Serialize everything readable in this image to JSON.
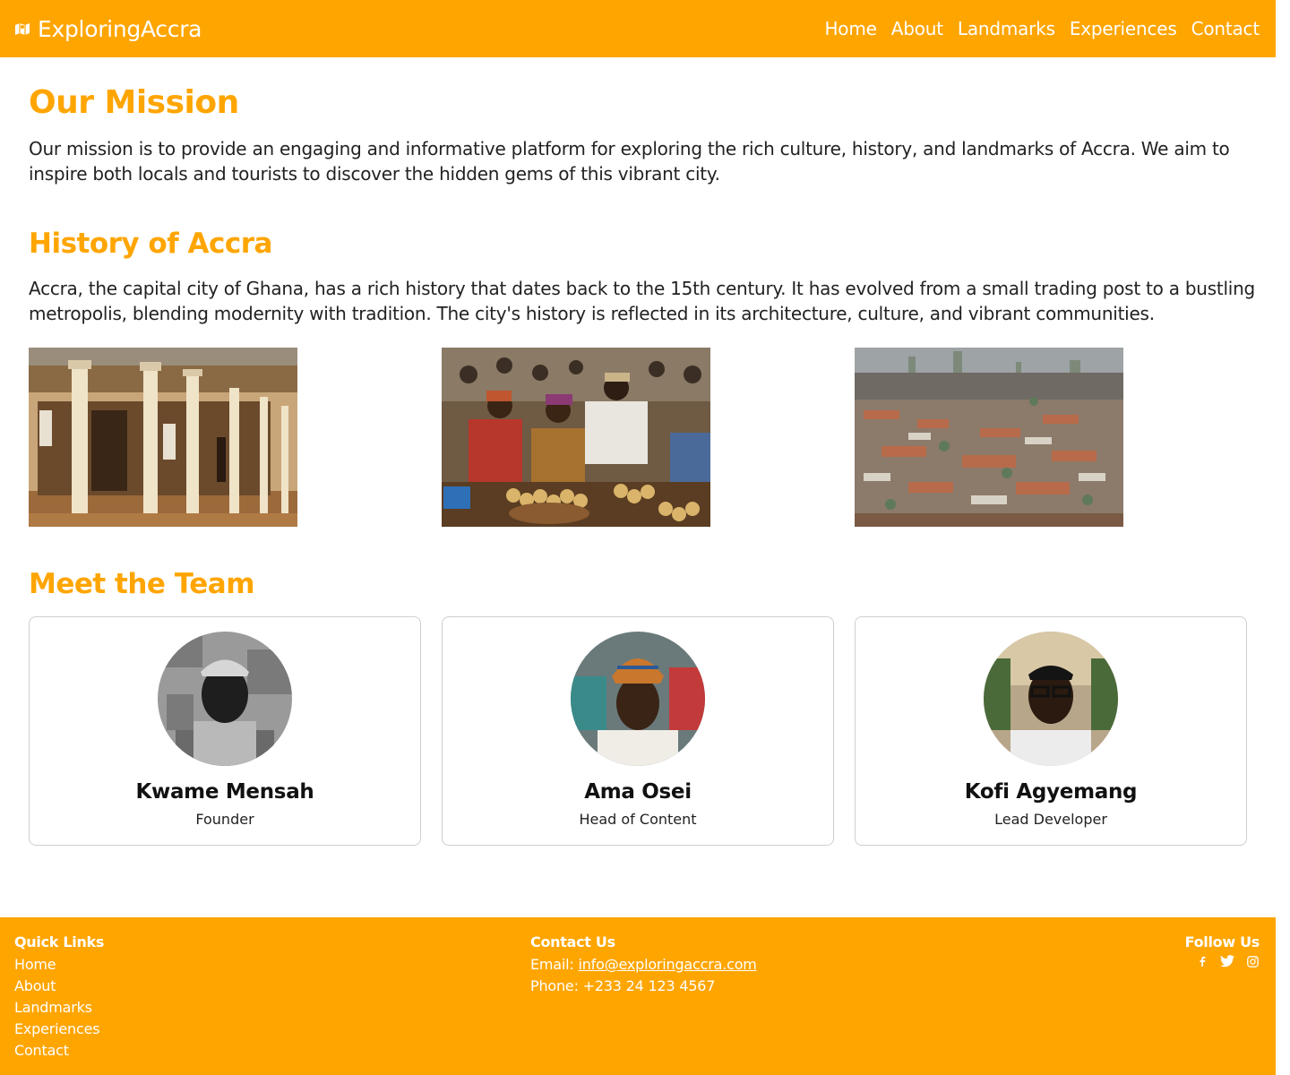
{
  "colors": {
    "accent": "#FFA500",
    "text": "#222222",
    "white": "#FFFFFF"
  },
  "header": {
    "brand": "ExploringAccra",
    "brand_icon": "map-icon",
    "nav": [
      "Home",
      "About",
      "Landmarks",
      "Experiences",
      "Contact"
    ]
  },
  "mission": {
    "title": "Our Mission",
    "text": "Our mission is to provide an engaging and informative platform for exploring the rich culture, history, and landmarks of Accra. We aim to inspire both locals and tourists to discover the hidden gems of this vibrant city."
  },
  "history": {
    "title": "History of Accra",
    "text": "Accra, the capital city of Ghana, has a rich history that dates back to the 15th century. It has evolved from a small trading post to a bustling metropolis, blending modernity with tradition. The city's history is reflected in its architecture, culture, and vibrant communities."
  },
  "team": {
    "title": "Meet the Team",
    "members": [
      {
        "name": "Kwame Mensah",
        "role": "Founder"
      },
      {
        "name": "Ama Osei",
        "role": "Head of Content"
      },
      {
        "name": "Kofi Agyemang",
        "role": "Lead Developer"
      }
    ]
  },
  "footer": {
    "quick_links": {
      "heading": "Quick Links",
      "items": [
        "Home",
        "About",
        "Landmarks",
        "Experiences",
        "Contact"
      ]
    },
    "contact": {
      "heading": "Contact Us",
      "email_label": "Email:",
      "email": "info@exploringaccra.com",
      "phone": "Phone: +233 24 123 4567"
    },
    "follow": {
      "heading": "Follow Us",
      "icons": [
        "facebook-icon",
        "twitter-icon",
        "instagram-icon"
      ]
    }
  }
}
